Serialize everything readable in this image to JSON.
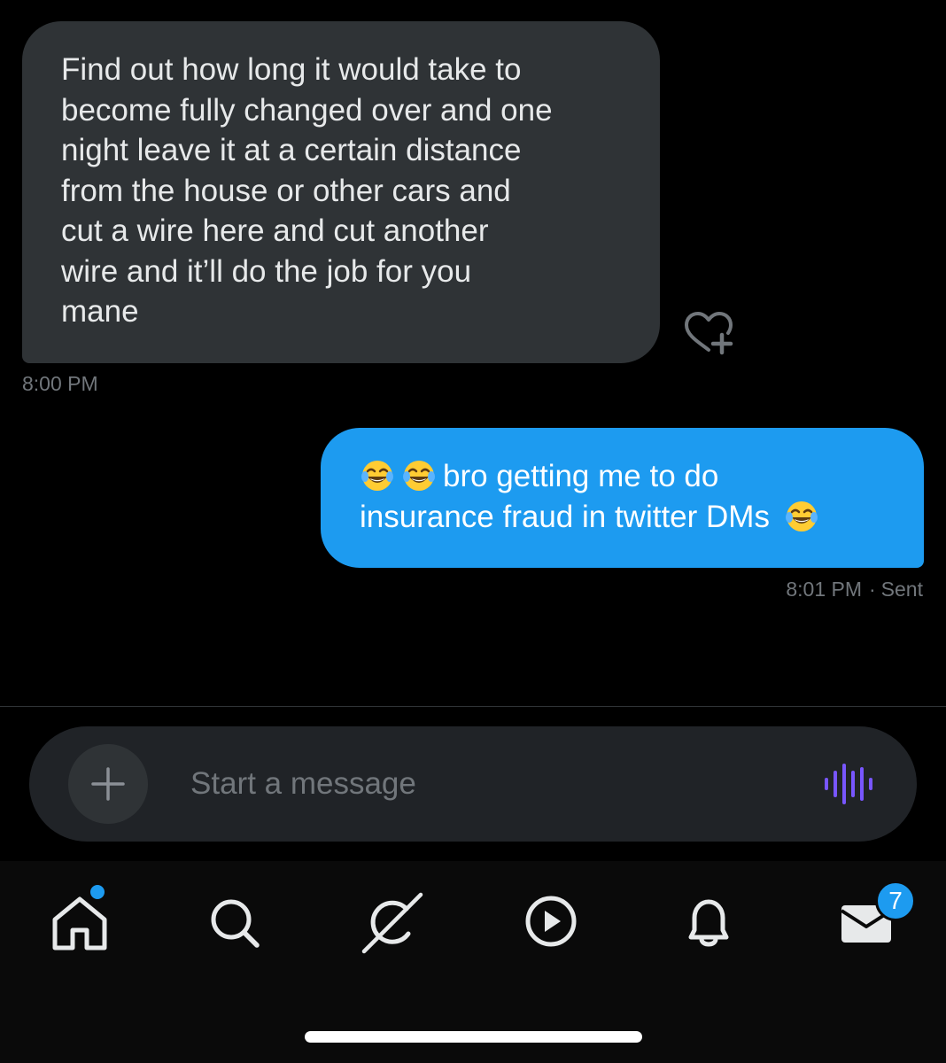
{
  "conversation": {
    "received": {
      "lines": [
        "Find out how long it would take to",
        "become fully changed over and one",
        "night leave it at a certain distance",
        "from the house or other cars and",
        "cut a wire here and cut another",
        "wire and it’ll do the job for you",
        "mane"
      ],
      "time": "8:00 PM",
      "like_icon": "heart-plus-icon"
    },
    "sent": {
      "line1_text": "bro getting me to do",
      "line2_text": "insurance fraud in twitter DMs",
      "emoji": "face-with-tears-of-joy",
      "time": "8:01 PM",
      "separator": "·",
      "status": "Sent"
    }
  },
  "composer": {
    "placeholder": "Start a message",
    "add_icon": "plus-icon",
    "voice_icon": "voice-waveform-icon"
  },
  "tabbar": {
    "items": [
      {
        "name": "home",
        "icon": "home-icon",
        "has_dot": true
      },
      {
        "name": "search",
        "icon": "search-icon"
      },
      {
        "name": "grok",
        "icon": "grok-icon"
      },
      {
        "name": "video",
        "icon": "play-icon"
      },
      {
        "name": "notifications",
        "icon": "bell-icon"
      },
      {
        "name": "messages",
        "icon": "envelope-icon",
        "badge": "7"
      }
    ]
  },
  "colors": {
    "background": "#000000",
    "received_bubble": "#2f3336",
    "sent_bubble": "#1d9bf0",
    "secondary_text": "#71767b",
    "voice_accent": "#7856ff",
    "badge": "#1d9bf0"
  }
}
